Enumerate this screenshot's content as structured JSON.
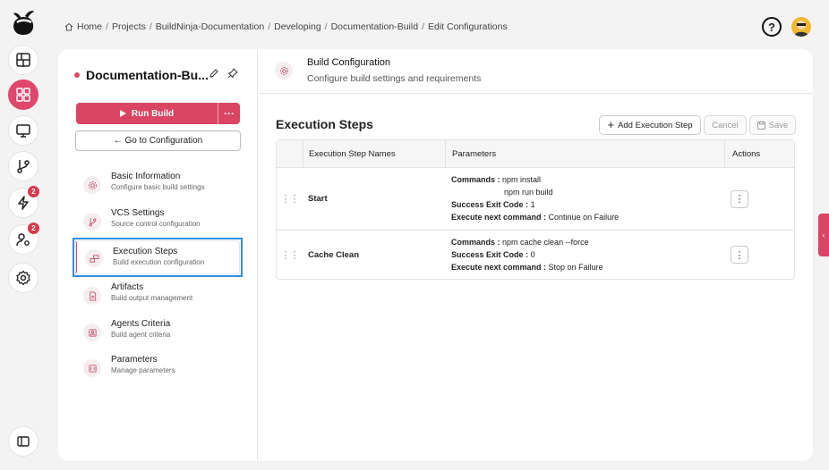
{
  "breadcrumb": {
    "items": [
      "Home",
      "Projects",
      "BuildNinja-Documentation",
      "Developing",
      "Documentation-Build",
      "Edit Configurations"
    ],
    "separator": "/"
  },
  "topbar": {
    "help_icon": "question-circle-icon",
    "avatar_icon": "user-avatar-icon"
  },
  "rail": {
    "badges": {
      "builds": "2",
      "agents": "2"
    },
    "active_color": "#e0476b"
  },
  "project": {
    "name": "Documentation-Bu...",
    "run_label": "Run Build",
    "more_label": "···",
    "goto_label": "← Go to Configuration"
  },
  "nav": [
    {
      "label": "Basic Information",
      "sub": "Configure basic build settings",
      "icon": "gear-icon"
    },
    {
      "label": "VCS Settings",
      "sub": "Source control configuration",
      "icon": "git-branch-icon"
    },
    {
      "label": "Execution Steps",
      "sub": "Build execution configuration",
      "icon": "steps-icon"
    },
    {
      "label": "Artifacts",
      "sub": "Build output management",
      "icon": "file-icon"
    },
    {
      "label": "Agents Criteria",
      "sub": "Build agent criteria",
      "icon": "agent-icon"
    },
    {
      "label": "Parameters",
      "sub": "Manage parameters",
      "icon": "parameters-icon"
    }
  ],
  "header": {
    "title": "Build Configuration",
    "subtitle": "Configure build settings and requirements"
  },
  "section": {
    "title": "Execution Steps",
    "add_label": "Add Execution Step",
    "cancel_label": "Cancel",
    "save_label": "Save"
  },
  "table": {
    "headers": [
      "Execution Step Names",
      "Parameters",
      "Actions"
    ],
    "labels": {
      "commands": "Commands :",
      "exit_code": "Success Exit Code :",
      "next": "Execute next command :"
    },
    "rows": [
      {
        "name": "Start",
        "commands": [
          "npm install",
          "npm run build"
        ],
        "exit_code": "1",
        "next": "Continue on Failure"
      },
      {
        "name": "Cache Clean",
        "commands": [
          "npm cache clean --force"
        ],
        "exit_code": "0",
        "next": "Stop on Failure"
      }
    ]
  },
  "side_tab": {
    "label": "‹"
  },
  "colors": {
    "accent": "#d94563",
    "focus": "#2e8fe0"
  }
}
